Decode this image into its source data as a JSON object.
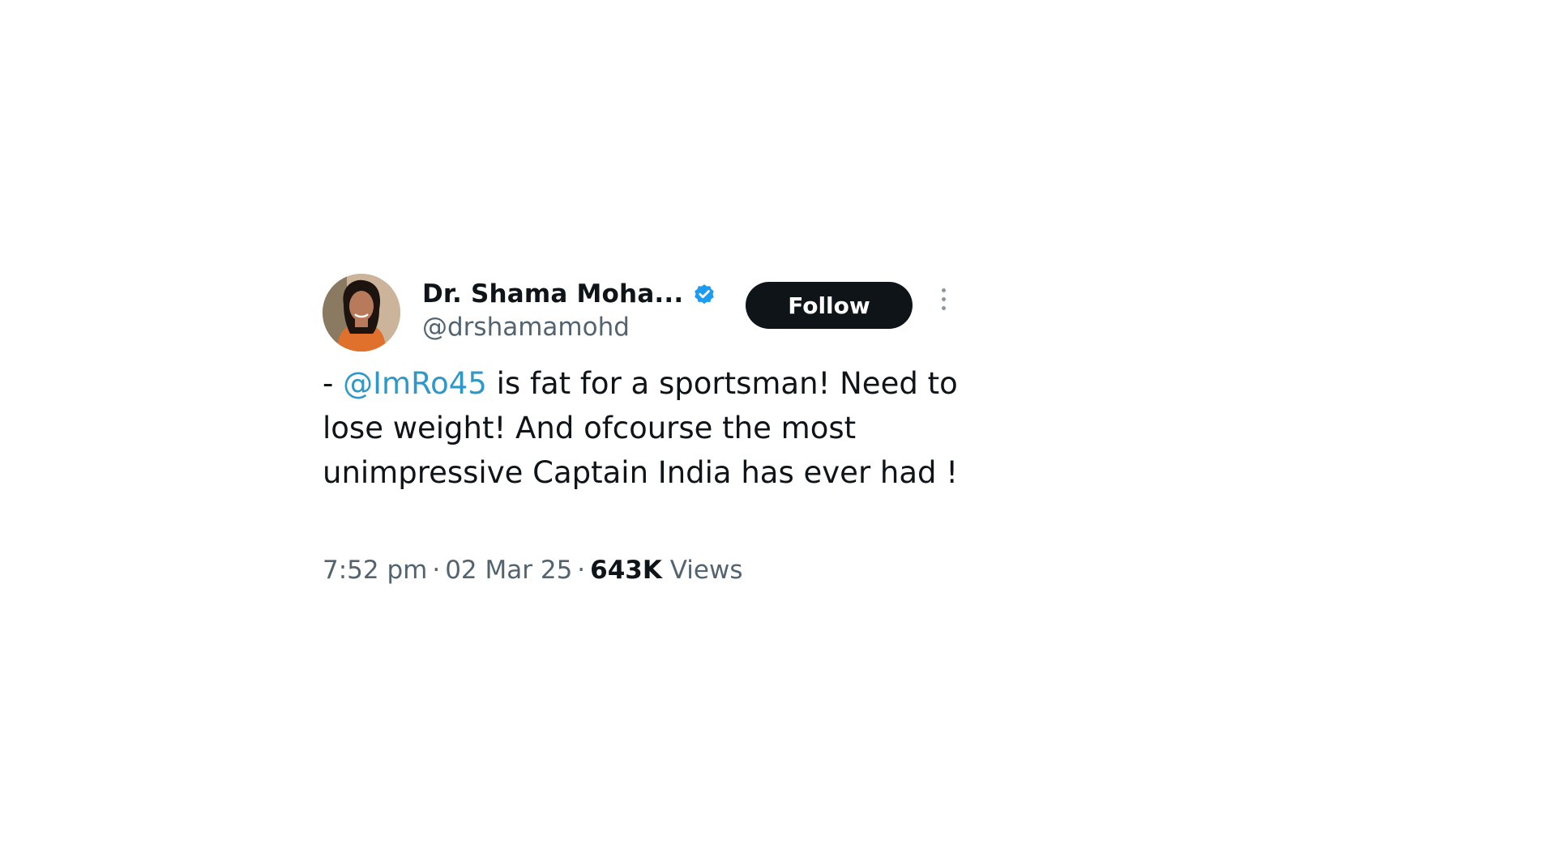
{
  "tweet": {
    "author": {
      "name": "Dr. Shama Moha...",
      "handle": "@drshamamohd",
      "verified": true
    },
    "follow_label": "Follow",
    "body": {
      "prefix": "- ",
      "mention": "@ImRo45",
      "text": " is fat for a sportsman! Need to lose weight! And ofcourse the most unimpressive Captain India has ever had  !"
    },
    "meta": {
      "time": "7:52 pm",
      "date": "02 Mar 25",
      "views_count": "643K",
      "views_label": "Views",
      "separator": "·"
    }
  },
  "colors": {
    "mention": "#2e98c8",
    "verified_badge": "#1d9bf0",
    "follow_button_bg": "#0f1419",
    "secondary_text": "#536471"
  },
  "icons": {
    "verified": "verified-badge-icon",
    "more": "more-vertical-icon"
  }
}
